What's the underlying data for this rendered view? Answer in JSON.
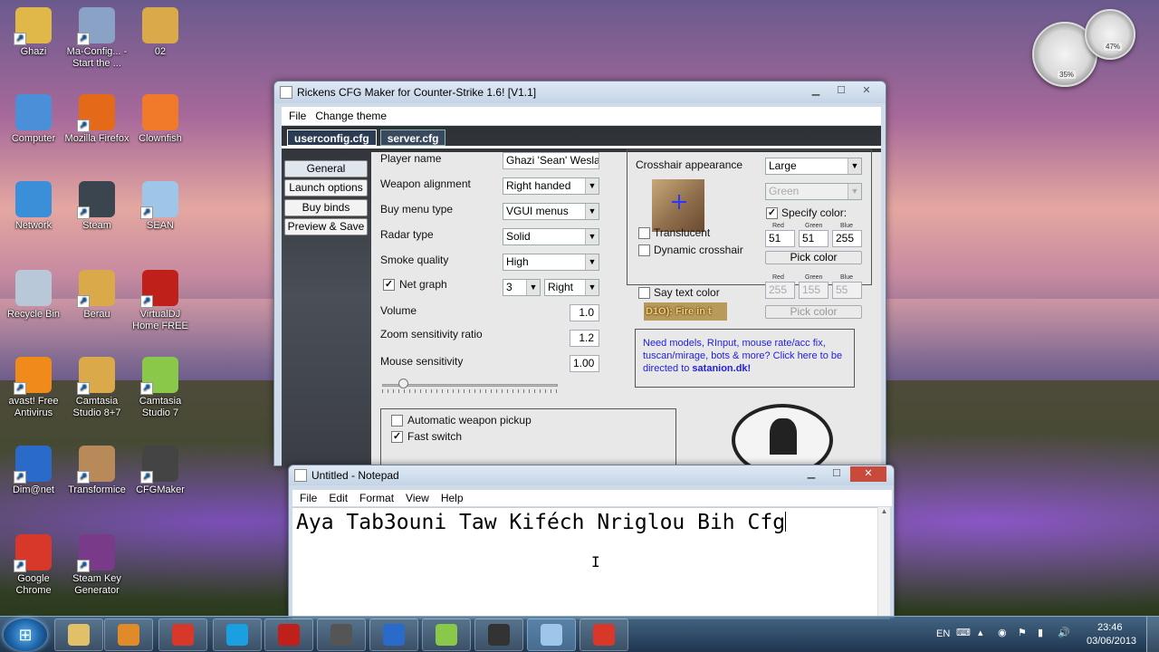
{
  "desktop_icons": [
    {
      "label": "Ghazi",
      "icon": "user-folder-icon",
      "color": "#e0b84a"
    },
    {
      "label": "Ma-Config... - Start the ...",
      "icon": "config-shortcut-icon",
      "color": "#8aa2c6"
    },
    {
      "label": "02",
      "icon": "folder-icon",
      "color": "#d9a94a"
    },
    {
      "label": "Computer",
      "icon": "computer-icon",
      "color": "#4a8fd8"
    },
    {
      "label": "Mozilla Firefox",
      "icon": "firefox-icon",
      "color": "#e46a1a"
    },
    {
      "label": "Clownfish",
      "icon": "clownfish-icon",
      "color": "#f07a2a"
    },
    {
      "label": "Network",
      "icon": "network-icon",
      "color": "#3a8fd8"
    },
    {
      "label": "Steam",
      "icon": "steam-icon",
      "color": "#3a4550"
    },
    {
      "label": "SEAN",
      "icon": "document-icon",
      "color": "#9ec6e8"
    },
    {
      "label": "Recycle Bin",
      "icon": "recycle-bin-icon",
      "color": "#b8c8d8"
    },
    {
      "label": "Berau",
      "icon": "folder-icon",
      "color": "#d9a94a"
    },
    {
      "label": "VirtualDJ Home FREE",
      "icon": "virtualdj-icon",
      "color": "#c0201a"
    },
    {
      "label": "avast! Free Antivirus",
      "icon": "avast-icon",
      "color": "#f08a1a"
    },
    {
      "label": "Camtasia Studio 8+7",
      "icon": "folder-icon",
      "color": "#d9a94a"
    },
    {
      "label": "Camtasia Studio 7",
      "icon": "camtasia-icon",
      "color": "#8ac84a"
    },
    {
      "label": "Dim@net",
      "icon": "3g-modem-icon",
      "color": "#2a6ac8"
    },
    {
      "label": "Transformice",
      "icon": "transformice-icon",
      "color": "#b88a5a"
    },
    {
      "label": "CFGMaker",
      "icon": "counter-strike-icon",
      "color": "#444444"
    },
    {
      "label": "Google Chrome",
      "icon": "chrome-icon",
      "color": "#d8382a"
    },
    {
      "label": "Steam Key Generator",
      "icon": "winrar-icon",
      "color": "#7a3a8a"
    }
  ],
  "gadgets": {
    "cpu_label": "35%",
    "mem_label": "47%"
  },
  "cfg_window": {
    "title": "Rickens CFG Maker for Counter-Strike 1.6! [V1.1]",
    "menu": [
      "File",
      "Change theme"
    ],
    "tabs": [
      "userconfig.cfg",
      "server.cfg"
    ],
    "side_buttons": [
      "General",
      "Launch options",
      "Buy binds",
      "Preview & Save"
    ],
    "fields": {
      "player_name_label": "Player name",
      "player_name_value": "Ghazi 'Sean' Weslati",
      "weapon_alignment_label": "Weapon alignment",
      "weapon_alignment_value": "Right handed",
      "buy_menu_label": "Buy menu type",
      "buy_menu_value": "VGUI menus",
      "radar_label": "Radar type",
      "radar_value": "Solid",
      "smoke_label": "Smoke quality",
      "smoke_value": "High",
      "net_graph_label": "Net graph",
      "net_graph_num": "3",
      "net_graph_pos": "Right",
      "volume_label": "Volume",
      "volume_value": "1.0",
      "zoom_label": "Zoom sensitivity ratio",
      "zoom_value": "1.2",
      "mouse_label": "Mouse sensitivity",
      "mouse_value": "1.00",
      "auto_pickup_label": "Automatic weapon pickup",
      "fast_switch_label": "Fast switch"
    },
    "mouse_slider_fraction": 0.1,
    "crosshair": {
      "label": "Crosshair appearance",
      "size": "Large",
      "color_preset": "Green",
      "translucent_label": "Translucent",
      "dynamic_label": "Dynamic crosshair",
      "specify_label": "Specify color:",
      "r_label": "Red",
      "g_label": "Green",
      "b_label": "Blue",
      "r": "51",
      "g": "51",
      "b": "255",
      "pick_label": "Pick color"
    },
    "say_text": {
      "label": "Say text color",
      "preview": "D1O): Fire in t",
      "r_label": "Red",
      "g_label": "Green",
      "b_label": "Blue",
      "r": "255",
      "g": "155",
      "b": "55",
      "pick_label": "Pick color"
    },
    "promo": {
      "text": "Need models, RInput, mouse rate/acc fix, tuscan/mirage, bots & more? Click here to be directed to ",
      "link": "satanion.dk!"
    }
  },
  "notepad": {
    "title": "Untitled - Notepad",
    "menu": [
      "File",
      "Edit",
      "Format",
      "View",
      "Help"
    ],
    "content": "Aya Tab3ouni Taw Kiféch Nriglou Bih Cfg"
  },
  "taskbar": {
    "apps": [
      {
        "icon": "explorer-icon",
        "color": "#e2c06a"
      },
      {
        "icon": "media-player-icon",
        "color": "#e08a2a"
      },
      {
        "icon": "chrome-icon",
        "color": "#d8382a"
      },
      {
        "icon": "skype-icon",
        "color": "#1aa0e0"
      },
      {
        "icon": "virtualdj-icon",
        "color": "#c0201a"
      },
      {
        "icon": "camtasia-recorder-icon",
        "color": "#555555"
      },
      {
        "icon": "media-center-icon",
        "color": "#2a6ac8"
      },
      {
        "icon": "camtasia-icon",
        "color": "#8ac84a"
      },
      {
        "icon": "camera-icon",
        "color": "#333333"
      },
      {
        "icon": "notepad-icon",
        "color": "#9ec6e8"
      },
      {
        "icon": "java-icon",
        "color": "#d8382a"
      }
    ],
    "lang": "EN",
    "time": "23:46",
    "date": "03/06/2013"
  }
}
